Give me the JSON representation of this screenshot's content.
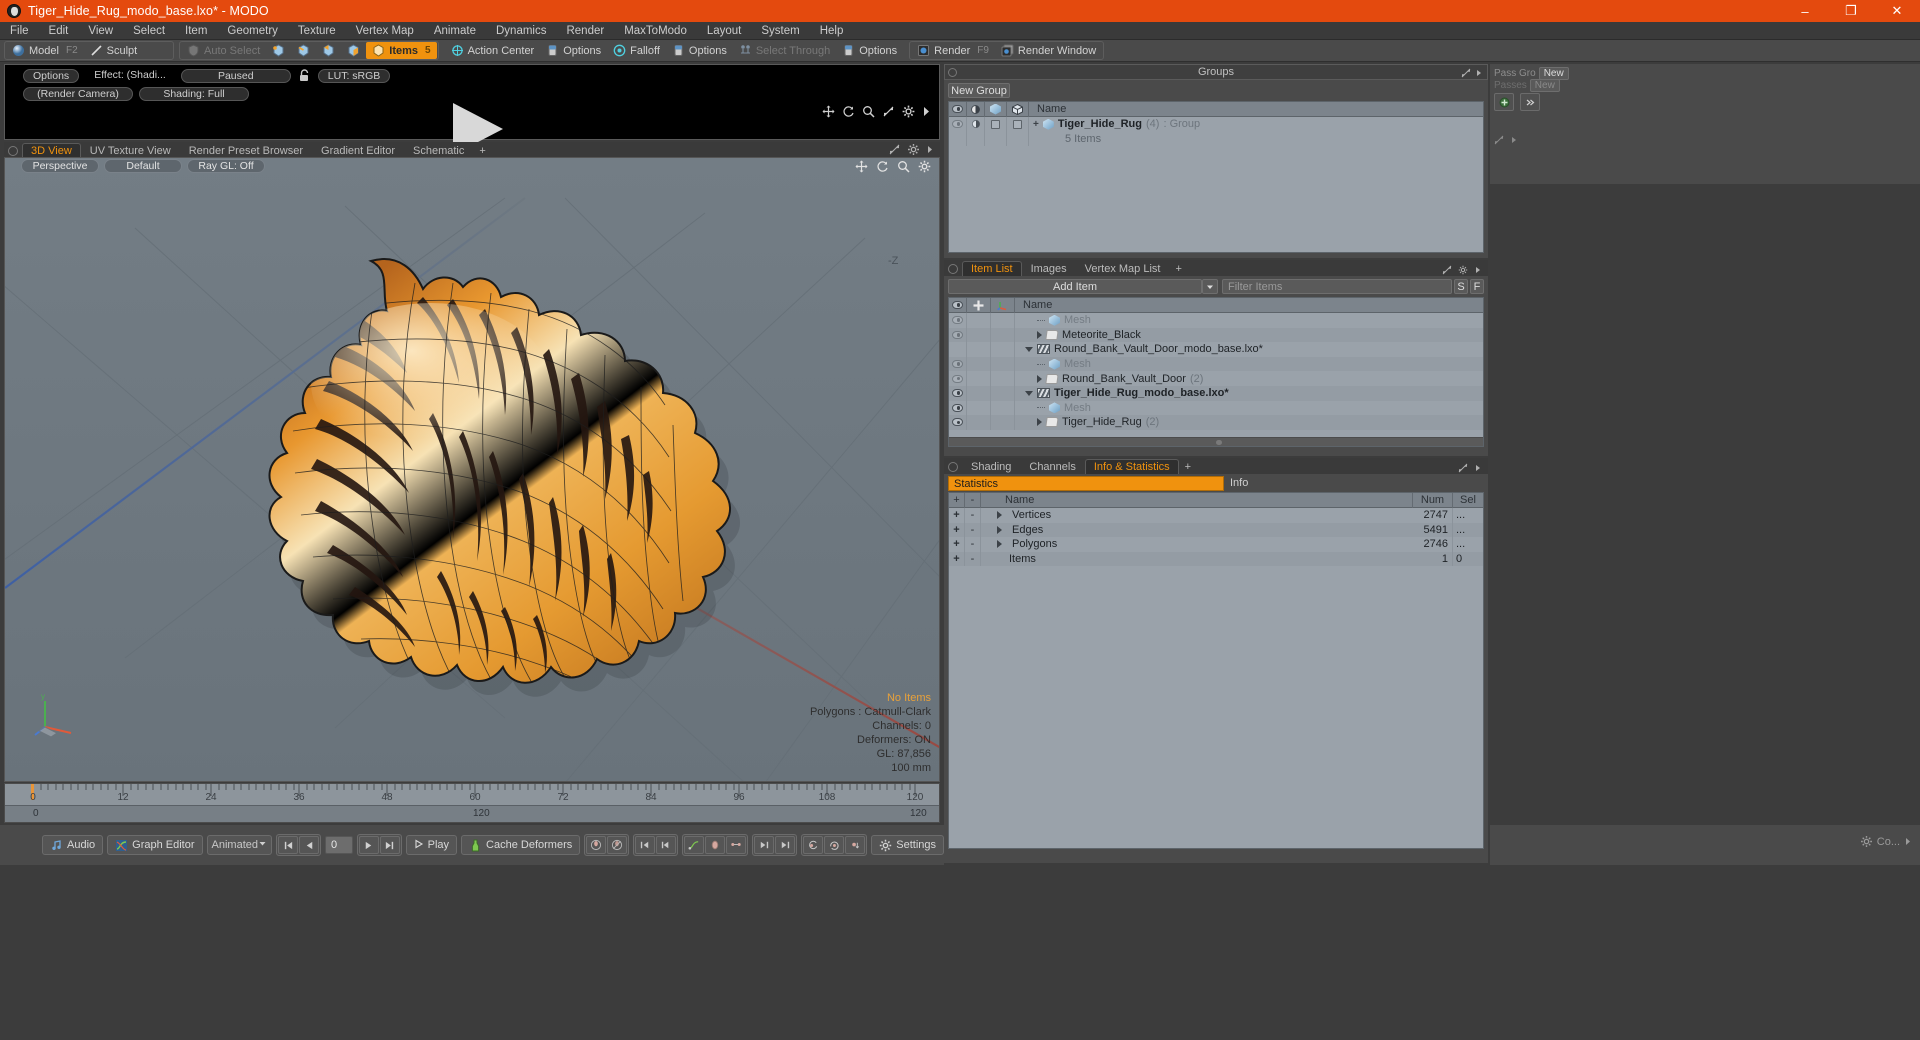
{
  "window": {
    "title": "Tiger_Hide_Rug_modo_base.lxo* - MODO",
    "app_icon": "modo-icon",
    "minimize": "–",
    "maximize": "❐",
    "close": "✕"
  },
  "menu": [
    "File",
    "Edit",
    "View",
    "Select",
    "Item",
    "Geometry",
    "Texture",
    "Vertex Map",
    "Animate",
    "Dynamics",
    "Render",
    "MaxToModo",
    "Layout",
    "System",
    "Help"
  ],
  "modebar": {
    "mode_group": [
      {
        "label": "Model",
        "key": "F2",
        "icon": "sphere-icon",
        "state": "off"
      },
      {
        "label": "Sculpt",
        "key": "",
        "icon": "sculpt-icon",
        "state": "off"
      }
    ],
    "select_group": [
      {
        "label": "Auto Select",
        "icon": "shield-icon",
        "state": "dim"
      },
      {
        "label": "",
        "icon": "vertex-select-icon",
        "state": "off"
      },
      {
        "label": "",
        "icon": "edge-select-icon",
        "state": "off"
      },
      {
        "label": "",
        "icon": "polygon-select-icon",
        "state": "off"
      },
      {
        "label": "",
        "icon": "material-select-icon",
        "state": "off"
      },
      {
        "label": "Items",
        "key": "5",
        "icon": "item-select-icon",
        "state": "on"
      }
    ],
    "action_group": [
      {
        "label": "Action Center",
        "icon": "action-center-icon",
        "state": "off"
      },
      {
        "label": "Options",
        "icon": "options-icon",
        "state": "off"
      },
      {
        "label": "Falloff",
        "icon": "falloff-icon",
        "state": "off"
      },
      {
        "label": "Options",
        "icon": "options-icon",
        "state": "off"
      },
      {
        "label": "Select Through",
        "icon": "select-through-icon",
        "state": "dim"
      },
      {
        "label": "Options",
        "icon": "options-icon",
        "state": "off"
      }
    ],
    "render_group": [
      {
        "label": "Render",
        "key": "F9",
        "icon": "render-icon",
        "state": "off"
      },
      {
        "label": "Render Window",
        "icon": "render-window-icon",
        "state": "off"
      }
    ]
  },
  "render_preview": {
    "options": "Options",
    "effect": "Effect: (Shadi...",
    "status": "Paused",
    "lock_icon": "unlock-icon",
    "lut": "LUT: sRGB",
    "camera": "(Render Camera)",
    "shading": "Shading: Full",
    "tools": [
      "move-icon",
      "rotate-icon",
      "zoom-icon",
      "fit-icon",
      "gear-icon",
      "arrow-icon"
    ]
  },
  "viewport": {
    "tabs": [
      {
        "label": "3D View",
        "active": true
      },
      {
        "label": "UV Texture View",
        "active": false
      },
      {
        "label": "Render Preset Browser",
        "active": false
      },
      {
        "label": "Gradient Editor",
        "active": false
      },
      {
        "label": "Schematic",
        "active": false
      },
      {
        "label": "+",
        "active": false
      }
    ],
    "header": {
      "projection": "Perspective",
      "preset": "Default",
      "raygl": "Ray GL: Off",
      "tools": [
        "move-icon",
        "rotate-icon",
        "zoom-icon",
        "gear-icon"
      ]
    },
    "axis_label_z": "-Z",
    "stats": [
      "No Items",
      "Polygons : Catmull-Clark",
      "Channels: 0",
      "Deformers: ON",
      "GL: 87,856",
      "100 mm"
    ],
    "model_name": "tiger-hide-rug-mesh"
  },
  "timeline": {
    "ticks": [
      "0",
      "12",
      "24",
      "36",
      "48",
      "60",
      "72",
      "84",
      "96",
      "108",
      "120"
    ],
    "range_start": "0",
    "range_mid": "120",
    "range_end": "120"
  },
  "bottom_toolbar": {
    "audio": "Audio",
    "graph_editor": "Graph Editor",
    "mode": "Animated",
    "frame_value": "0",
    "play": "Play",
    "cache_deformers": "Cache Deformers",
    "settings": "Settings",
    "transport": [
      "go-start-icon",
      "step-back-icon",
      "step-forward-icon",
      "go-end-icon"
    ],
    "key_tools": [
      "key-icon",
      "key-delete-icon",
      "prev-key-icon",
      "next-key-icon",
      "curve-icon",
      "ellipse-icon",
      "handles-icon",
      "in-icon",
      "out-icon",
      "rotate-key-icon",
      "cycle-icon",
      "delete-key-icon"
    ]
  },
  "groups_panel": {
    "title": "Groups",
    "new_group_button": "New Group",
    "columns": [
      "eye-icon",
      "shading-icon",
      "cube-icon",
      "cube-outline-icon",
      "Name"
    ],
    "rows": [
      {
        "name": "Tiger_Hide_Rug",
        "count": "(4)",
        "type": ": Group",
        "sub": "5 Items",
        "icon": "cube-icon",
        "bold": true
      }
    ]
  },
  "item_list_panel": {
    "tabs": [
      {
        "label": "Item List",
        "active": true
      },
      {
        "label": "Images",
        "active": false
      },
      {
        "label": "Vertex Map List",
        "active": false
      },
      {
        "label": "+",
        "active": false
      }
    ],
    "add_item": "Add Item",
    "filter_placeholder": "Filter Items",
    "filter_buttons": [
      "S",
      "F"
    ],
    "columns": [
      "eye-icon",
      "lock-icon",
      "axis-icon",
      "Name"
    ],
    "rows": [
      {
        "indent": 2,
        "name": "Mesh",
        "icon": "cube-icon",
        "grey": true,
        "eye": "dim",
        "expander": "none"
      },
      {
        "indent": 2,
        "name": "Meteorite_Black",
        "icon": "folder-icon",
        "grey": false,
        "eye": "dim",
        "expander": "right"
      },
      {
        "indent": 1,
        "name": "Round_Bank_Vault_Door_modo_base.lxo*",
        "icon": "scene-icon",
        "grey": false,
        "eye": "none",
        "expander": "down"
      },
      {
        "indent": 2,
        "name": "Mesh",
        "icon": "cube-icon",
        "grey": true,
        "eye": "dim",
        "expander": "none"
      },
      {
        "indent": 2,
        "name": "Round_Bank_Vault_Door",
        "count": "(2)",
        "icon": "folder-icon",
        "grey": false,
        "eye": "dim",
        "expander": "right"
      },
      {
        "indent": 1,
        "name": "Tiger_Hide_Rug_modo_base.lxo*",
        "icon": "scene-icon",
        "grey": false,
        "bold": true,
        "eye": "on",
        "expander": "down"
      },
      {
        "indent": 2,
        "name": "Mesh",
        "icon": "cube-icon",
        "grey": true,
        "eye": "on",
        "expander": "none"
      },
      {
        "indent": 2,
        "name": "Tiger_Hide_Rug",
        "count": "(2)",
        "icon": "folder-icon",
        "grey": false,
        "eye": "on",
        "expander": "right"
      }
    ]
  },
  "info_panel": {
    "tabs": [
      {
        "label": "Shading",
        "active": false
      },
      {
        "label": "Channels",
        "active": false
      },
      {
        "label": "Info & Statistics",
        "active": true
      },
      {
        "label": "+",
        "active": false
      }
    ],
    "statistics_label": "Statistics",
    "info_label": "Info",
    "columns": [
      "+",
      "-",
      "Name",
      "Num",
      "Sel"
    ],
    "rows": [
      {
        "name": "Vertices",
        "num": "2747",
        "sel": "..."
      },
      {
        "name": "Edges",
        "num": "5491",
        "sel": "..."
      },
      {
        "name": "Polygons",
        "num": "2746",
        "sel": "..."
      },
      {
        "name": "Items",
        "num": "1",
        "sel": "0"
      }
    ]
  },
  "pass_column": {
    "pass_gp_label": "Pass Gro",
    "pass_gp_button": "New",
    "passes_label": "Passes",
    "passes_button": "New",
    "icons": [
      "add-icon",
      "arrow-icon"
    ]
  },
  "status_right": {
    "label": "Co...",
    "icons": [
      "gear-icon",
      "chevron-icon"
    ]
  },
  "colors": {
    "title_bar": "#e44a0e",
    "accent": "#f0920e",
    "panel_bg": "#4a4a4a",
    "viewport_bg": "#6e7880",
    "list_bg": "#9aa2aa"
  }
}
